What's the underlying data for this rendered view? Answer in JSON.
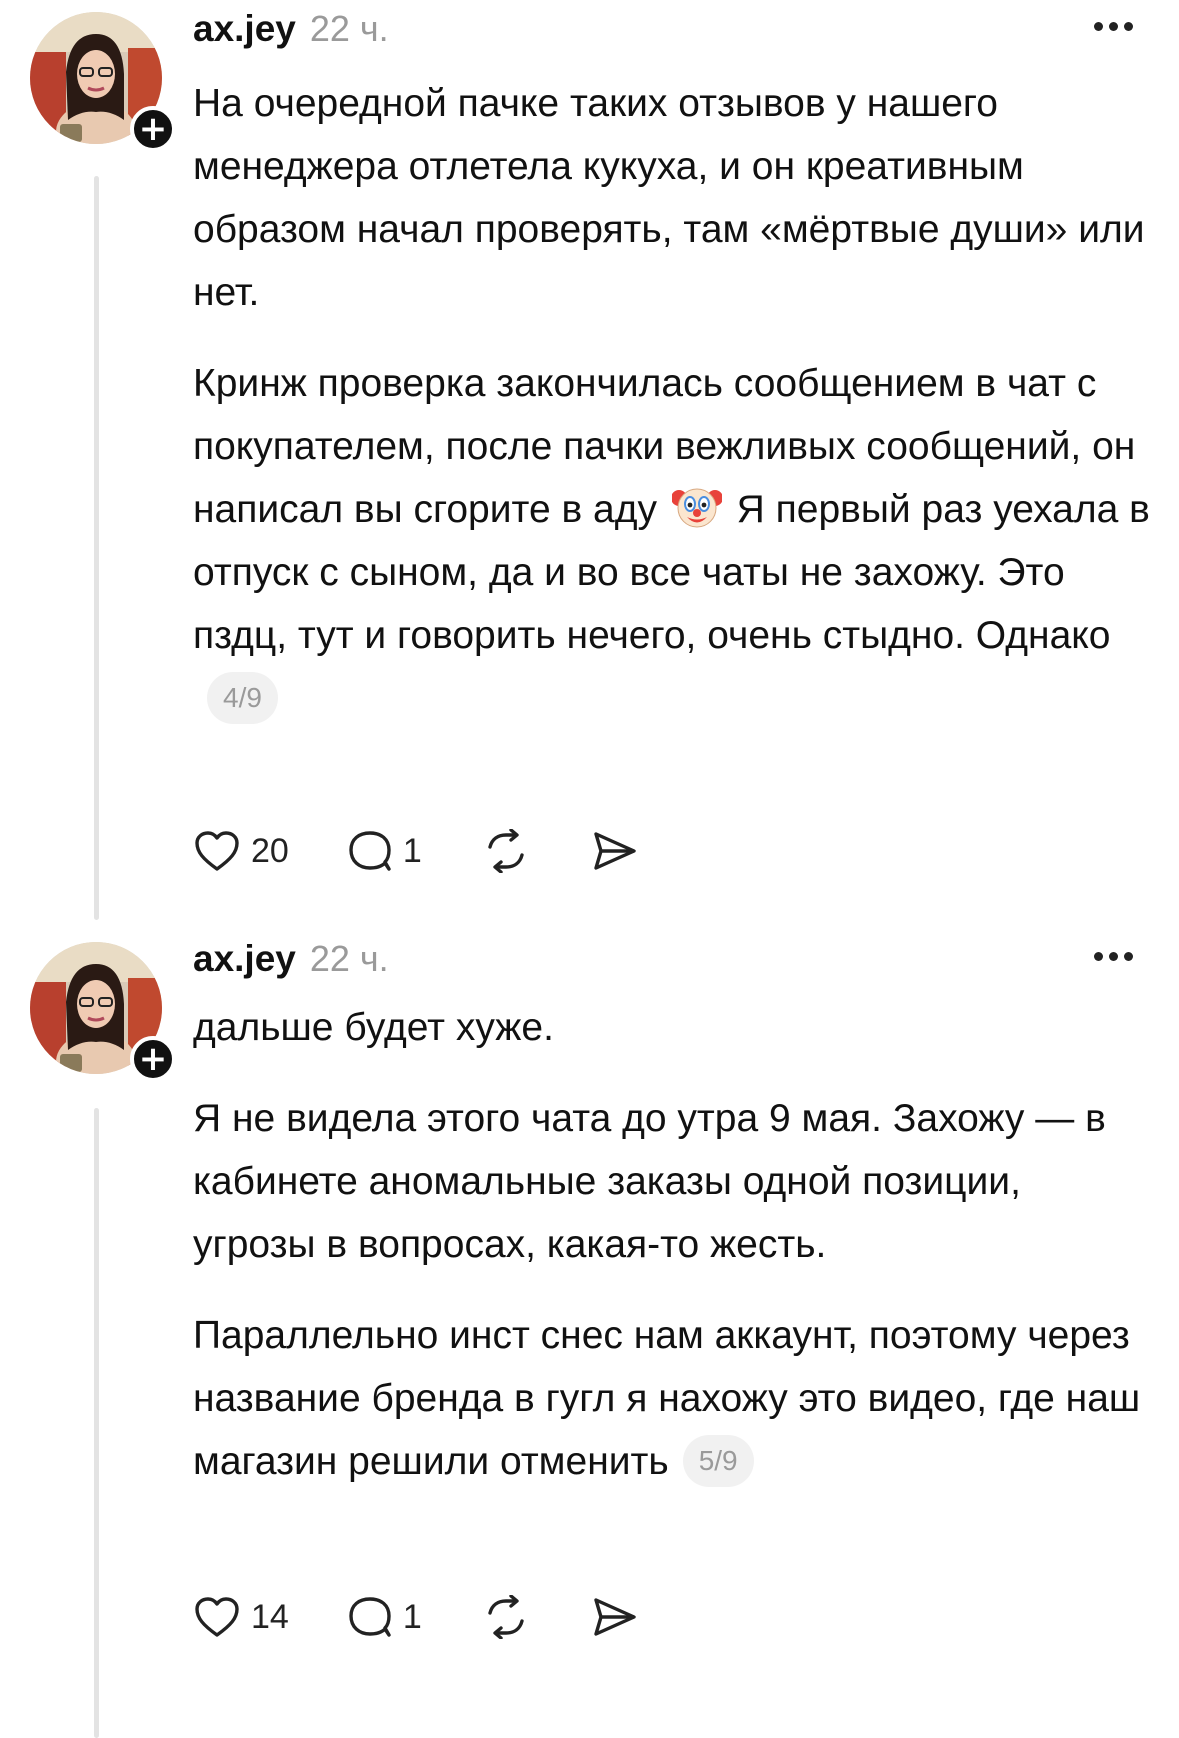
{
  "posts": [
    {
      "author": "ax.jey",
      "time": "22 ч.",
      "paragraph1": "На очередной пачке таких отзывов у нашего менеджера отлетела кукуха, и он креативным образом начал проверять, там «мёртвые души» или нет.",
      "paragraph2_part1": "Кринж проверка закончилась сообщением в чат с покупателем, после пачки вежливых сообщений, он написал вы сгорите в аду",
      "emoji": "clown-face-emoji",
      "paragraph2_part2": "Я первый раз уехала в отпуск с сыном, да и во все чаты не захожу. Это пздц, тут и говорить нечего, очень стыдно. Однако",
      "counter": "4/9",
      "likes": "20",
      "replies": "1"
    },
    {
      "author": "ax.jey",
      "time": "22 ч.",
      "paragraph1": "дальше будет хуже.",
      "paragraph2": "Я не видела этого чата до утра 9 мая. Захожу — в кабинете аномальные заказы одной позиции, угрозы в вопросах, какая-то жесть.",
      "paragraph3": "Параллельно инст снес нам аккаунт, поэтому через название бренда в гугл я нахожу это видео, где наш магазин решили отменить",
      "counter": "5/9",
      "likes": "14",
      "replies": "1"
    }
  ],
  "icons": {
    "like": "heart-icon",
    "reply": "comment-icon",
    "repost": "repost-icon",
    "share": "share-icon",
    "more": "more-icon",
    "follow": "plus-icon"
  },
  "colors": {
    "text": "#111111",
    "muted": "#9a9a9a",
    "thread_line": "#e3e3e3",
    "counter_bg": "#f1f1f1"
  }
}
